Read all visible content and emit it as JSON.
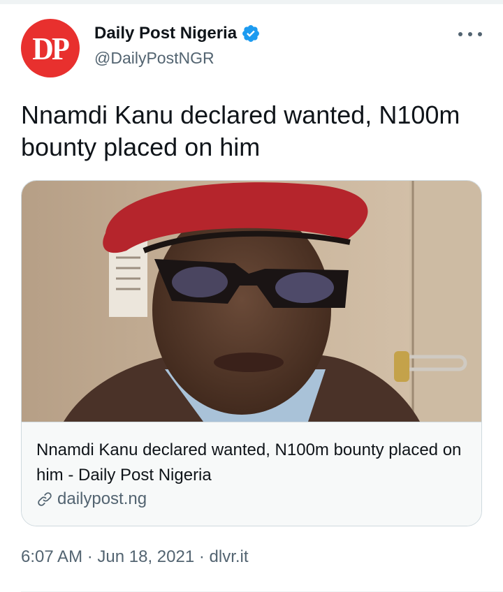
{
  "author": {
    "avatar_text": "DP",
    "avatar_color": "#e8302e",
    "display_name": "Daily Post Nigeria",
    "handle": "@DailyPostNGR",
    "verified": true,
    "verified_color": "#1d9bf0"
  },
  "more_icon": "ellipsis-icon",
  "tweet": {
    "text": "Nnamdi Kanu declared wanted, N100m bounty placed on him"
  },
  "card": {
    "image_description_icon": "photo",
    "title": "Nnamdi Kanu declared wanted, N100m bounty placed on him - Daily Post Nigeria",
    "domain_icon": "link-icon",
    "domain": "dailypost.ng"
  },
  "meta": {
    "time": "6:07 AM",
    "separator": " · ",
    "date": "Jun 18, 2021",
    "source": "dlvr.it"
  },
  "colors": {
    "text_primary": "#0f1419",
    "text_secondary": "#536471",
    "border": "#cfd9de"
  }
}
